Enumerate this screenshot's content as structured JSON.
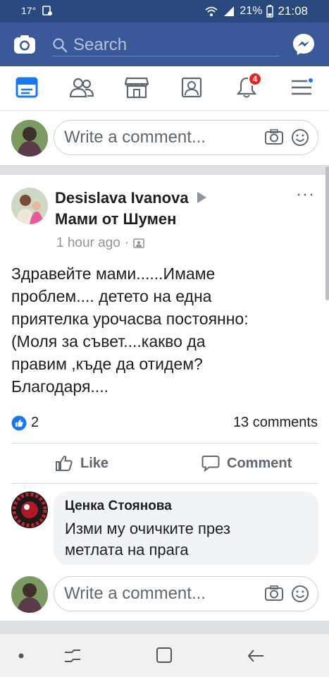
{
  "status_bar": {
    "temperature": "17°",
    "battery": "21%",
    "time": "21:08"
  },
  "top_bar": {
    "search_label": "Search",
    "icons": [
      "camera-icon",
      "search-icon",
      "messenger-icon"
    ]
  },
  "nav": {
    "tabs": [
      "news-feed-icon",
      "friends-icon",
      "marketplace-icon",
      "profile-icon",
      "notifications-icon",
      "menu-icon"
    ],
    "notification_count": "4"
  },
  "comment_placeholder": "Write a comment...",
  "post": {
    "author": "Desislava Ivanova",
    "group": "Мами от Шумен",
    "time": "1 hour ago",
    "text_lines": [
      "Здравейте мами......Имаме",
      "проблем.... детето на една",
      "приятелка урочасва постоянно:",
      "(Моля за съвет....какво да",
      "правим ,къде да отидем?",
      "Благодаря...."
    ],
    "reactions_count": "2",
    "comments_count": "13 comments",
    "like_label": "Like",
    "comment_label": "Comment"
  },
  "reply": {
    "name": "Ценка Стоянова",
    "text_lines": [
      "Изми му очичките през",
      "метлата на прага"
    ]
  },
  "colors": {
    "brand": "#3b5998",
    "status_bar": "#29487d",
    "like_blue": "#1877f2",
    "badge_red": "#e02424"
  }
}
